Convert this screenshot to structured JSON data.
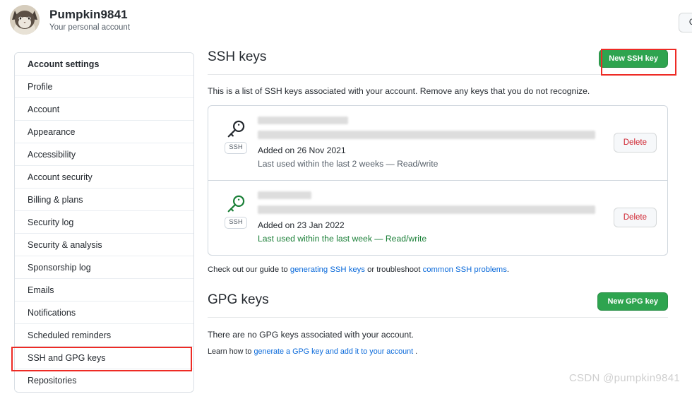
{
  "account": {
    "name": "Pumpkin9841",
    "subtitle": "Your personal account",
    "avatar_icon": "cat-avatar",
    "goto_button": "Go to y"
  },
  "sidebar": {
    "header": "Account settings",
    "items": [
      {
        "label": "Profile"
      },
      {
        "label": "Account"
      },
      {
        "label": "Appearance"
      },
      {
        "label": "Accessibility"
      },
      {
        "label": "Account security"
      },
      {
        "label": "Billing & plans"
      },
      {
        "label": "Security log"
      },
      {
        "label": "Security & analysis"
      },
      {
        "label": "Sponsorship log"
      },
      {
        "label": "Emails"
      },
      {
        "label": "Notifications"
      },
      {
        "label": "Scheduled reminders"
      },
      {
        "label": "SSH and GPG keys"
      },
      {
        "label": "Repositories"
      }
    ],
    "highlighted_item": "SSH and GPG keys"
  },
  "ssh_section": {
    "title": "SSH keys",
    "new_key_button": "New SSH key",
    "description": "This is a list of SSH keys associated with your account. Remove any keys that you do not recognize.",
    "keys": [
      {
        "badge": "SSH",
        "key_icon": "key-icon",
        "key_icon_color": "#24292f",
        "title_redacted": true,
        "fingerprint_redacted": true,
        "added": "Added on 26 Nov 2021",
        "last_used": "Last used within the last 2 weeks — Read/write",
        "last_used_active": false,
        "delete_button": "Delete"
      },
      {
        "badge": "SSH",
        "key_icon": "key-icon",
        "key_icon_color": "#1a7f37",
        "title_redacted": true,
        "fingerprint_redacted": true,
        "added": "Added on 23 Jan 2022",
        "last_used": "Last used within the last week — Read/write",
        "last_used_active": true,
        "delete_button": "Delete"
      }
    ],
    "guide": {
      "part1": "Check out our guide to ",
      "link1": "generating SSH keys",
      "part2": " or troubleshoot ",
      "link2": "common SSH problems",
      "part3": "."
    }
  },
  "gpg_section": {
    "title": "GPG keys",
    "new_key_button": "New GPG key",
    "empty_message": "There are no GPG keys associated with your account.",
    "learn": {
      "part1": "Learn how to ",
      "link1": "generate a GPG key and add it to your account",
      "part2": " ."
    }
  },
  "watermark": "CSDN @pumpkin9841",
  "colors": {
    "green_button": "#2ea44f",
    "link": "#0969da",
    "delete_text": "#cf222e",
    "annotation_red": "#ee2b25",
    "active_green": "#1a7f37"
  }
}
